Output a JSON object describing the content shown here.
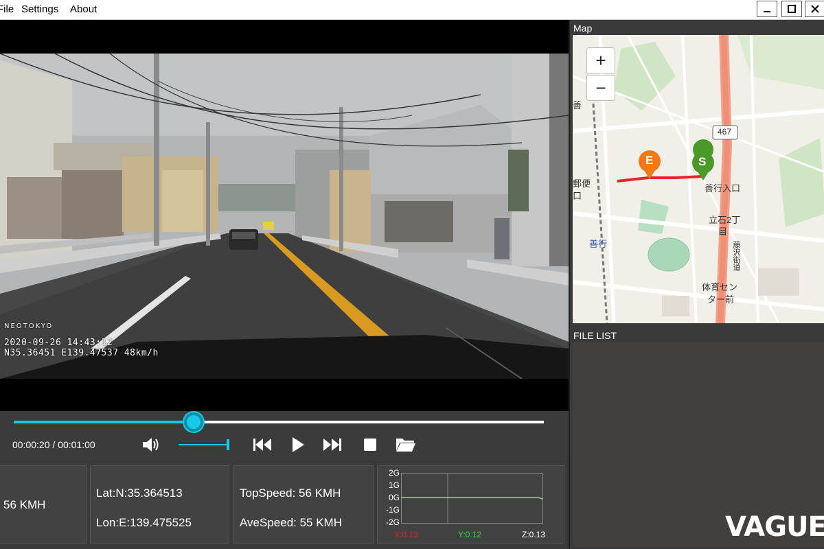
{
  "menu": {
    "file": "File",
    "settings": "Settings",
    "about": "About"
  },
  "video": {
    "brand": "NEOTOKYO",
    "stamp_time": "2020-09-26 14:43:12",
    "stamp_gps": "N35.36451 E139.47537 48km/h"
  },
  "player": {
    "time": "00:00:20 / 00:01:00",
    "progress_fraction": 0.34,
    "volume_fraction": 1.0,
    "accent": "#17c9e6"
  },
  "info": {
    "speed": "56 KMH",
    "lat": "Lat:N:35.364513",
    "lon": "Lon:E:139.475525",
    "top_speed": "TopSpeed: 56 KMH",
    "ave_speed": "AveSpeed: 55 KMH"
  },
  "gsensor": {
    "ticks": [
      "2G",
      "1G",
      "0G",
      "-1G",
      "-2G"
    ],
    "x": "X:0.13",
    "y": "Y:0.12",
    "z": "Z:0.13",
    "x_color": "#e02020",
    "y_color": "#20e040",
    "z_color": "#ffffff"
  },
  "map": {
    "label": "Map",
    "zoom_in": "+",
    "zoom_out": "−",
    "route_label": "467",
    "start_marker": "S",
    "end_marker": "E",
    "labels": {
      "zenko_iriguchi": "善行入口",
      "tateishi_line1": "立石2丁",
      "tateishi_line2": "目",
      "zengyo": "善行",
      "taiiku_line1": "体育セン",
      "taiiku_line2": "ター前",
      "post": "郵便",
      "office": "口",
      "left_top": "善",
      "road_name": "藤沢街道"
    },
    "route_color": "#e8232a",
    "start_color": "#4a9a2a",
    "end_color": "#f07a18"
  },
  "file_list": {
    "label": "FILE LIST",
    "watermark": "VAGUE"
  }
}
